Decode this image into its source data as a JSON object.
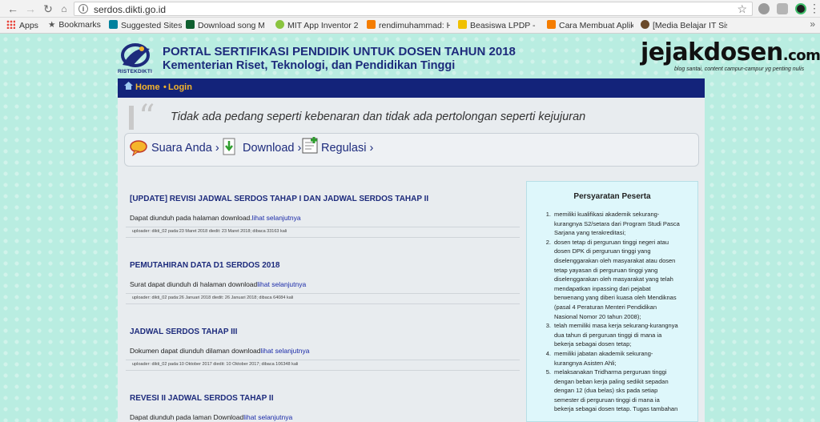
{
  "browser": {
    "url": "serdos.dikti.go.id",
    "bookmarks": [
      {
        "label": "Apps",
        "icon": "apps-grid-icon"
      },
      {
        "label": "Bookmarks",
        "icon": "star-icon"
      },
      {
        "label": "Suggested Sites",
        "icon": "bing-icon"
      },
      {
        "label": "Download song Mus",
        "icon": "music-n-icon"
      },
      {
        "label": "MIT App Inventor 2",
        "icon": "app-inventor-icon"
      },
      {
        "label": "rendimuhammad: H",
        "icon": "blogger-icon"
      },
      {
        "label": "Beasiswa LPDP - Log",
        "icon": "lpdp-icon"
      },
      {
        "label": "Cara Membuat Aplik",
        "icon": "blogger-icon"
      },
      {
        "label": "[Media Belajar IT Sis",
        "icon": "avatar-icon"
      }
    ]
  },
  "header": {
    "title": "PORTAL SERTIFIKASI PENDIDIK UNTUK DOSEN TAHUN 2018",
    "subtitle": "Kementerian Riset, Teknologi, dan Pendidikan Tinggi",
    "logo_text": "RISTEKDIKTI"
  },
  "watermark": {
    "name": "jejakdosen",
    "suffix": ".com",
    "tagline": "blog santai, content campur-campur yg penting nulis"
  },
  "nav": {
    "home": "Home",
    "separator": "•",
    "login": "Login"
  },
  "quote": "Tidak ada pedang seperti kebenaran dan tidak ada pertolongan seperti kejujuran",
  "menu": [
    {
      "label": "Suara Anda",
      "arrow": "›",
      "icon": "speech-bubble-icon"
    },
    {
      "label": "Download",
      "arrow": "›",
      "icon": "download-icon"
    },
    {
      "label": "Regulasi",
      "arrow": "›",
      "icon": "regulation-icon"
    }
  ],
  "posts": [
    {
      "title": "[UPDATE] REVISI JADWAL SERDOS TAHAP I DAN JADWAL SERDOS TAHAP II",
      "body": "Dapat diunduh pada halaman download.",
      "link": "lihat selanjutnya",
      "meta": "uploader: dikti_02 pada:23 Maret 2018 diedit: 23 Maret 2018; dibaca 33163 kali"
    },
    {
      "title": "PEMUTAHIRAN DATA D1 SERDOS 2018",
      "body": "Surat dapat diunduh di halaman download",
      "link": "lihat selanjutnya",
      "meta": "uploader: dikti_02 pada:26 Januari 2018 diedit: 26 Januari 2018; dibaca 64084 kali"
    },
    {
      "title": "JADWAL SERDOS TAHAP III",
      "body": "Dokumen dapat diunduh dilaman download",
      "link": "lihat selanjutnya",
      "meta": "uploader: dikti_02 pada:10 Oktober 2017 diedit: 10 Oktober 2017; dibaca 106348 kali"
    },
    {
      "title": "REVESI II JADWAL SERDOS TAHAP II",
      "body": "Dapat diunduh pada laman Download",
      "link": "lihat selanjutnya",
      "meta": ""
    }
  ],
  "sidebar": {
    "title": "Persyaratan Peserta",
    "items": [
      {
        "num": "1.",
        "lines": [
          "memiliki kualifikasi akademik sekurang-",
          "kurangnya S2/setara dari Program Studi Pasca",
          "Sarjana yang terakreditasi;"
        ]
      },
      {
        "num": "2.",
        "lines": [
          "dosen tetap di perguruan tinggi negeri atau",
          "dosen DPK di perguruan tinggi yang",
          "diselenggarakan oleh masyarakat atau dosen",
          "tetap yayasan di perguruan tinggi yang",
          "diselenggarakan oleh masyarakat yang telah",
          "mendapatkan inpassing dari pejabat",
          "berwenang yang diberi kuasa oleh Mendiknas",
          "(pasal 4 Peraturan Menteri Pendidikan",
          "Nasional Nomor 20 tahun 2008);"
        ]
      },
      {
        "num": "3.",
        "lines": [
          "telah memiliki masa kerja sekurang-kurangnya",
          "dua tahun di perguruan tinggi di mana ia",
          "bekerja sebagai dosen tetap;"
        ]
      },
      {
        "num": "4.",
        "lines": [
          "memiliki jabatan akademik sekurang-",
          "kurangnya Asisten Ahli;"
        ]
      },
      {
        "num": "5.",
        "lines": [
          "melaksanakan Tridharma perguruan tinggi",
          "dengan beban kerja paling sedikit sepadan",
          "dengan 12 (dua belas) sks pada setiap",
          "semester di perguruan tinggi di mana ia",
          "bekerja sebagai dosen tetap. Tugas tambahan"
        ]
      }
    ]
  }
}
